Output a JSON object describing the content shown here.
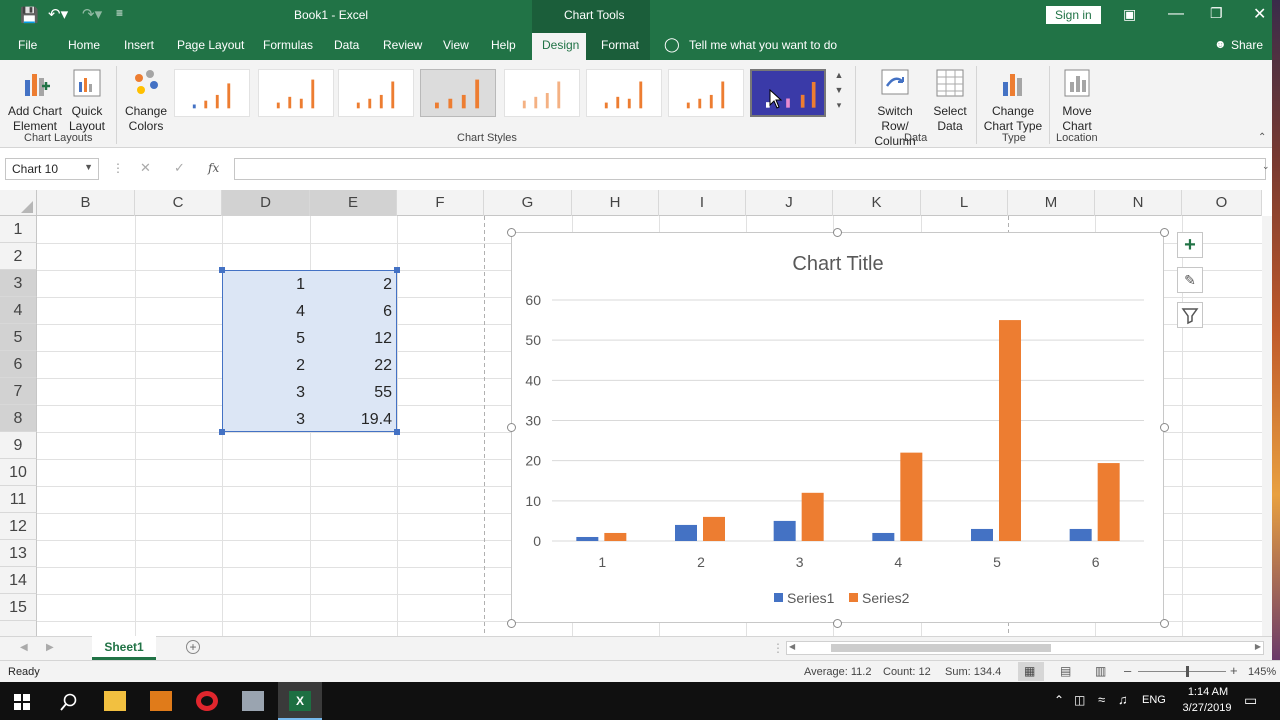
{
  "titlebar": {
    "title": "Book1  -  Excel",
    "context_tab": "Chart Tools",
    "sign_in": "Sign in"
  },
  "tabs": [
    {
      "label": "File"
    },
    {
      "label": "Home"
    },
    {
      "label": "Insert"
    },
    {
      "label": "Page Layout"
    },
    {
      "label": "Formulas"
    },
    {
      "label": "Data"
    },
    {
      "label": "Review"
    },
    {
      "label": "View"
    },
    {
      "label": "Help"
    },
    {
      "label": "Design"
    },
    {
      "label": "Format"
    }
  ],
  "tell_me": "Tell me what you want to do",
  "share": "Share",
  "ribbon": {
    "add_chart_element": "Add Chart Element",
    "quick_layout": "Quick Layout",
    "chart_layouts": "Chart Layouts",
    "change_colors": "Change Colors",
    "chart_styles": "Chart Styles",
    "switch_row_column": "Switch Row/ Column",
    "select_data": "Select Data",
    "data_group": "Data",
    "change_chart_type": "Change Chart Type",
    "type_group": "Type",
    "move_chart": "Move Chart",
    "location_group": "Location"
  },
  "formula_bar": {
    "name_box": "Chart 10",
    "fx": "fx",
    "formula": ""
  },
  "columns": [
    "B",
    "C",
    "D",
    "E",
    "F",
    "G",
    "H",
    "I",
    "J",
    "K",
    "L",
    "M",
    "N",
    "O"
  ],
  "rows": [
    "1",
    "2",
    "3",
    "4",
    "5",
    "6",
    "7",
    "8",
    "9",
    "10",
    "11",
    "12",
    "13",
    "14",
    "15"
  ],
  "cells": {
    "D": [
      "1",
      "4",
      "5",
      "2",
      "3",
      "3"
    ],
    "E": [
      "2",
      "6",
      "12",
      "22",
      "55",
      "19.4"
    ]
  },
  "chart_data": {
    "type": "bar",
    "title": "Chart Title",
    "categories": [
      "1",
      "2",
      "3",
      "4",
      "5",
      "6"
    ],
    "series": [
      {
        "name": "Series1",
        "color": "#4472c4",
        "values": [
          1,
          4,
          5,
          2,
          3,
          3
        ]
      },
      {
        "name": "Series2",
        "color": "#ed7d31",
        "values": [
          2,
          6,
          12,
          22,
          55,
          19.4
        ]
      }
    ],
    "yticks": [
      "0",
      "10",
      "20",
      "30",
      "40",
      "50",
      "60"
    ],
    "ylim": [
      0,
      60
    ],
    "grid": true,
    "legend": "bottom"
  },
  "sheet_tab": "Sheet1",
  "status": {
    "ready": "Ready",
    "average": "Average: 11.2",
    "count": "Count: 12",
    "sum": "Sum: 134.4",
    "zoom": "145%"
  },
  "taskbar": {
    "lang": "ENG",
    "time": "1:14 AM",
    "date": "3/27/2019"
  },
  "colors": {
    "excel_green": "#217346",
    "selection": "#dce6f5"
  }
}
